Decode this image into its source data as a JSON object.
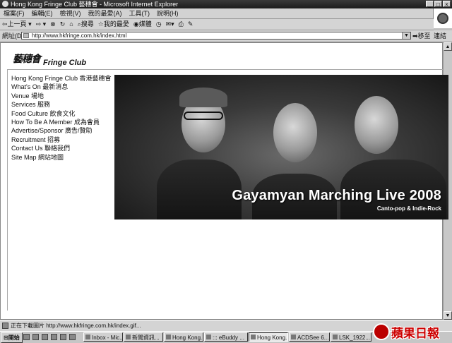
{
  "window": {
    "title": "Hong Kong Fringe Club 藝穗會 - Microsoft Internet Explorer"
  },
  "menu": [
    "檔案(F)",
    "編輯(E)",
    "檢視(V)",
    "我的最愛(A)",
    "工具(T)",
    "說明(H)"
  ],
  "toolbar": {
    "back": "上一頁",
    "search": "搜尋",
    "favorites": "我的最愛",
    "media": "媒體"
  },
  "address": {
    "label": "網址(D)",
    "url": "http://www.hkfringe.com.hk/index.html",
    "go": "移至",
    "links": "連結"
  },
  "page": {
    "logo_calligraphy": "藝穗會",
    "logo_text": "Fringe Club",
    "nav": [
      "Hong Kong Fringe Club 香港藝穗會",
      "What's On 最新消息",
      "Venue 場地",
      "Services 服務",
      "Food Culture 飲食文化",
      "How To Be A Member 成為會員",
      "Advertise/Sponsor 廣告/贊助",
      "Recruitment 招募",
      "Contact Us 聯絡我們",
      "Site Map 網站地圖"
    ],
    "hero": {
      "title": "Gayamyan Marching Live 2008",
      "subtitle": "Canto-pop & Indie-Rock"
    }
  },
  "statusbar": {
    "text": "正在下載圖片 http://www.hkfringe.com.hk/index.gif..."
  },
  "taskbar": {
    "start": "開始",
    "tasks": [
      "Inbox - Mic...",
      "新聞資訊...",
      "Hong Kong...",
      "::: eBuddy ...",
      "Hong Kong...",
      "ACDSee 6....",
      "LSK_1922..."
    ]
  },
  "watermark": "蘋果日報",
  "icons": {
    "back": "back-arrow-icon",
    "forward": "forward-arrow-icon",
    "stop": "stop-icon",
    "refresh": "refresh-icon",
    "home": "home-icon",
    "history": "history-icon",
    "mail": "mail-icon",
    "print": "print-icon",
    "edit": "edit-icon"
  }
}
